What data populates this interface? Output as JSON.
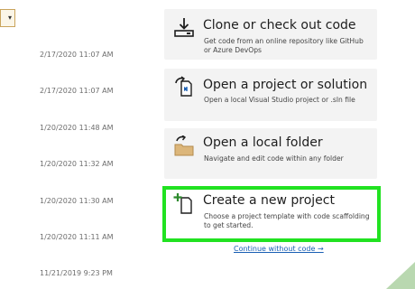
{
  "recent_dates": [
    "2/17/2020 11:07 AM",
    "2/17/2020 11:07 AM",
    "1/20/2020 11:48 AM",
    "1/20/2020 11:32 AM",
    "1/20/2020 11:30 AM",
    "1/20/2020 11:11 AM",
    "11/21/2019 9:23 PM"
  ],
  "actions": [
    {
      "title": "Clone or check out code",
      "desc": "Get code from an online repository like GitHub or Azure DevOps",
      "icon": "clone-icon"
    },
    {
      "title": "Open a project or solution",
      "desc": "Open a local Visual Studio project or .sln file",
      "icon": "open-project-icon"
    },
    {
      "title": "Open a local folder",
      "desc": "Navigate and edit code within any folder",
      "icon": "folder-icon"
    },
    {
      "title": "Create a new project",
      "desc": "Choose a project template with code scaffolding to get started.",
      "icon": "new-project-icon"
    }
  ],
  "continue_link": "Continue without code →",
  "colors": {
    "highlight": "#21e221",
    "card_bg": "#f3f3f3",
    "link": "#1a5fb4"
  }
}
